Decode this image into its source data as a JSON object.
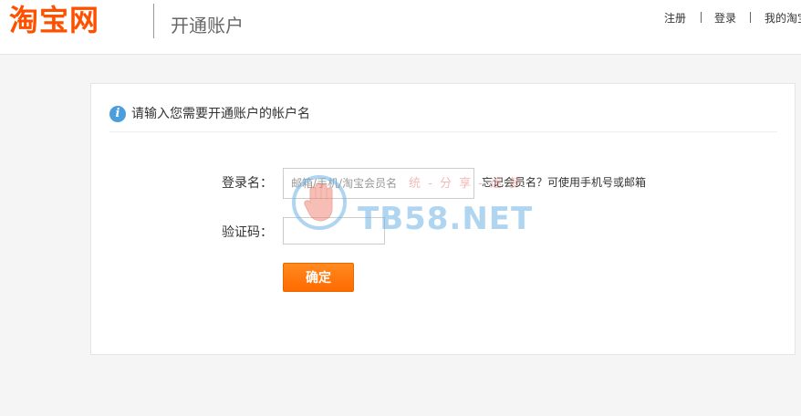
{
  "header": {
    "logo_text": "淘宝网",
    "title": "开通账户",
    "nav": {
      "register": "注册",
      "login": "登录",
      "my_taobao": "我的淘宝"
    }
  },
  "panel": {
    "tip": "请输入您需要开通账户的帐户名",
    "info_icon_glyph": "i",
    "form": {
      "account_label": "登录名：",
      "account_placeholder": "邮箱/手机/淘宝会员名",
      "account_value": "",
      "forgot_hint": "忘记会员名？可使用手机号或邮箱",
      "captcha_label": "验证码：",
      "captcha_value": "",
      "submit_label": "确定"
    }
  },
  "watermark": {
    "text": "TB58.NET",
    "subtext": "统 - 分 享 - 迷 梦"
  },
  "colors": {
    "brand_orange": "#ff5000",
    "button_orange": "#ff6a00",
    "info_blue": "#4a9edb"
  }
}
